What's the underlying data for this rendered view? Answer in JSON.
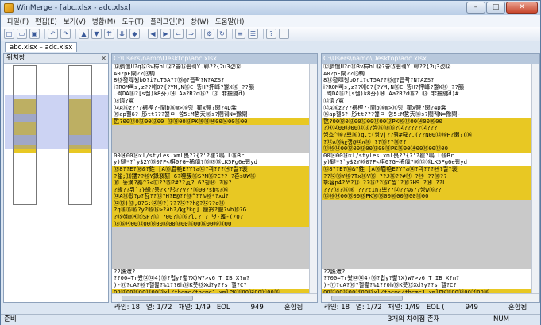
{
  "window": {
    "title": "WinMerge - [abc.xlsx - adc.xlsx]",
    "minimize": "–",
    "maximize": "□",
    "close": "✕"
  },
  "menu": [
    "파일(F)",
    "편집(E)",
    "보기(V)",
    "병합(M)",
    "도구(T)",
    "플러그인(P)",
    "창(W)",
    "도움말(H)"
  ],
  "toolbar_icons": [
    "new-icon",
    "open-icon",
    "save-icon",
    "sep",
    "undo-icon",
    "redo-icon",
    "sep",
    "prev-diff-icon",
    "next-diff-icon",
    "first-diff-icon",
    "last-diff-icon",
    "current-diff-icon",
    "sep",
    "copy-left-icon",
    "copy-right-icon",
    "copy-all-left-icon",
    "copy-all-right-icon",
    "sep",
    "options-icon",
    "refresh-icon",
    "sep",
    "compare-icon",
    "settings-icon",
    "sep",
    "help-icon",
    "about-icon"
  ],
  "tab": {
    "label": "abc.xlsx – adc.xlsx"
  },
  "location_pane": {
    "title": "위치창",
    "close": "✕"
  },
  "left": {
    "path": "C:\\Users\\namo\\Desktop\\abc.xlsx",
    "status": {
      "line": "라인: 18",
      "col": "열: 1/72",
      "char": "채널: 1/49",
      "eol": "EOL",
      "count": "949",
      "encoding": "혼합됨"
    },
    "lines": [
      {
        "t": "⑫臍慍U?q⑫3v椧hL⑫?쓩⑮휩퀘Y.鄲??{2ц3갮⑫",
        "k": ""
      },
      {
        "t": "A0?pF閘??⒀騊",
        "k": ""
      },
      {
        "t": "8⑮發噑뉭bD?i?cT5A??⑮@?흡좍?N?AZS?",
        "k": ""
      },
      {
        "t": "ⅰ?ROM삐s,z??얘0?{?YM,N⑯C 똥H?押峰?쐟X⑯_??韻",
        "k": ""
      },
      {
        "t": ".쩍DA⑯?[s쏄)k8芬)⑭ Aa?R?d⑯?  ⑬ 罪擔纏d)",
        "k": ""
      },
      {
        "t": "⑬遺?寬",
        "k": ""
      },
      {
        "t": "⑫A⑯z???襛樫?-閘b⑯W>⑯링  瞿x鹽?閑?4D喬",
        "k": ""
      },
      {
        "t": "⑯ap펠6?~肜tt???쐝ㅁ 쓩5:M乴天⑱s?閤퀘N=豫閘-",
        "k": ""
      },
      {
        "t": "乴?00⑬0⑬00⑬00  ⑬⑬00⑬PK⑯⑬⑭00⑭00⑯00",
        "k": "diff"
      },
      {
        "t": "",
        "k": "gap"
      },
      {
        "t": "",
        "k": "gap"
      },
      {
        "t": "",
        "k": "gap"
      },
      {
        "t": "",
        "k": "gap"
      },
      {
        "t": "00⑭00⑭xl/styles.xml畏??{?'?瞿?鳴 L⑯Br",
        "k": ""
      },
      {
        "t": "y)鐽*?`y$2Y⑯0?F<棋0?G~稀偉?⑯⑬⑯LK5Fg6e휩yd",
        "k": ""
      },
      {
        "t": "⑬8??E?⑱&?鉎 [A⑯眉艳E?Y?a⑫?긔???⑭?릴?裵",
        "k": "diff"
      },
      {
        "t": "?쑕;⒀鏤??⑯Y錄裵豣 6?噬簇⑯S?M⑯?C?? ?혼sUW⑯",
        "k": "diff"
      },
      {
        "t": "⑯ 똥溝?蓁^?<⑰??⑮?#??瓦? 6?뉭⑭ ?⑯?",
        "k": "diff"
      },
      {
        "t": "?緣??뤼`?}緣?뚱?k?肜??v??⑯00?sb%?⑯",
        "k": "diff"
      },
      {
        "t": "⑫A⑯탔?p?瓦??⑬?H?E@??⑬^??%⑯*?xd?",
        "k": "diff"
      },
      {
        "t": "⑫⑬)⑬,0?S:⑫⑫?)???⑫??h@?⑫??o⑬ ",
        "k": "diff"
      },
      {
        "t": "?q⑯⑯⑯?y?⑯⑯>?∂h?/㎏?kg] 瘦鈴?鹽?vb⑯?G",
        "k": "diff"
      },
      {
        "t": "?⑮혀@⑭⑮SP?⑬ ?00?⑬⑯?l.?  ?  볏-䩁-(/0?",
        "k": "diff"
      },
      {
        "t": "⑬⑯⑭00⑬00⑬00⑬00⑬00⑯00⑯00⑯⑬00",
        "k": "diff"
      },
      {
        "t": "",
        "k": "gap"
      },
      {
        "t": "",
        "k": "gap"
      },
      {
        "t": "",
        "k": "gap"
      },
      {
        "t": "",
        "k": "gap"
      },
      {
        "t": "",
        "k": "gap"
      },
      {
        "t": "",
        "k": "gap"
      },
      {
        "t": "?2讗遭?",
        "k": ""
      },
      {
        "t": "??00=Tr쐈⑫⑫4)⑯?렵y?쐝?X)W?>v6 T IB   X?m?",
        "k": ""
      },
      {
        "t": ")-⑪?cA?⑯?헬쬝?%1??0h⑮K쯧⑮Xd?y??s 헬?C?",
        "k": ""
      },
      {
        "t": "00⑬00⑯00⑭00⑬xl/theme/theme1.xmlPK⑪00⑫00⑭00⑯",
        "k": "diff"
      },
      {
        "t": "⑬00 ⑬00⑭00⑬ ⑯00 ⑬00⑯00⑯00⑬ ⑭00 ⑬00",
        "k": "diff"
      }
    ]
  },
  "right": {
    "path": "C:\\Users\\namo\\Desktop\\adc.xlsx",
    "status": {
      "line": "라인: 18",
      "col": "열: 1/72",
      "char": "채널: 1/49",
      "eol": "EOL (",
      "count": "949",
      "encoding": "혼합됨"
    },
    "lines": [
      {
        "t": "⑫臍慍U?q⑫3v椧hL⑫?쓩⑮휩퀘Y.鄲??{2ц3갮⑫",
        "k": ""
      },
      {
        "t": "A0?pF閘??⒀騊",
        "k": ""
      },
      {
        "t": "8⑮發噑뉭bD?i?cT5A??⑮@?흡좍?N?AZS?",
        "k": ""
      },
      {
        "t": "ⅰ?ROM삐s,z??얘0?{?YM,N⑯C 똥H?押峰?쐟X⑯_??韻",
        "k": ""
      },
      {
        "t": ".쩍DA⑯?[s쏄)k8芬)⑭ Aa?R?d⑯?  ⑬ 罪擔纏d)#",
        "k": ""
      },
      {
        "t": "⑬遺?寬",
        "k": ""
      },
      {
        "t": "⑫A⑯z???襛樫?-閘b⑯W>⑯링  瞿x鹽?閑?4D喬",
        "k": ""
      },
      {
        "t": "⑯ap펠6?~肜tt???쐝ㅁ 쓩5:M乴天⑱s?閤퀘N=豫閘-",
        "k": ""
      },
      {
        "t": "乴?00⑬0⑬00⑬00⑬00⑬PK⑯⑬00⑭00⑯00",
        "k": "diff"
      },
      {
        "t": "?⑭⑫00⑬00⑬⑬?쌍⑯⑬⑯?⑫?????⑫???",
        "k": "diff"
      },
      {
        "t": "쌍쇼^⑯?쁘⑯)q.t(쌍v|??쬠#舜?.(??N00⑬⑯F?懶?(⑯",
        "k": "diff"
      },
      {
        "t": "?⑫ʌ⑯㎏쟁@⑫ʌ⑯ ??⑯??⑯??",
        "k": "diff"
      },
      {
        "t": "⑬⑯⑭00⑬00⑬00⑬00⑬PK⑯00⑭00⑯00⑬00",
        "k": "diff"
      },
      {
        "t": "00⑭00⑭xl/styles.xml畏??{?'?瞿?鳴 L⑯Br",
        "k": ""
      },
      {
        "t": "y)鐽*?`y$2Y⑯0?F<棋0?G~稀偉?⑯⑬⑯LK5Fg6e휩yd",
        "k": ""
      },
      {
        "t": "⑬8??E?⑱&?鉎 [A⑯眉艳E?Y?a⑫?긔???⑭?릴?裵",
        "k": "diff"
      },
      {
        "t": "??⑫⑱Y⑯?Tx⑯V⑮ ??J⑯??#⑭ ?⑭ ??⑯??",
        "k": "diff"
      },
      {
        "t": "彰容p4?쏘?⑬ ??⑮??⑯C쌍`?⑯?H9 ?⑭ ??L",
        "k": "diff"
      },
      {
        "t": "???⑬?⑯⑱ ???t1n?쁘??⑫??%6??쌍w⑯??",
        "k": "diff"
      },
      {
        "t": "⑬⑯⑭00⑬00⑬PK⑯⑬00⑯00⑬00⑯00",
        "k": "diff"
      },
      {
        "t": "",
        "k": "gap"
      },
      {
        "t": "",
        "k": "gap"
      },
      {
        "t": "",
        "k": "gap"
      },
      {
        "t": "",
        "k": "gap"
      },
      {
        "t": "",
        "k": "gap"
      },
      {
        "t": "",
        "k": "gap"
      },
      {
        "t": "",
        "k": "gap"
      },
      {
        "t": "",
        "k": "gap"
      },
      {
        "t": "",
        "k": "gap"
      },
      {
        "t": "",
        "k": "gap"
      },
      {
        "t": "?2讗遭?",
        "k": ""
      },
      {
        "t": "??00=Tr쐈⑫⑫4)⑯?렵y?쐝?X)W?>v6 T IB   X?m?",
        "k": ""
      },
      {
        "t": ")-⑪?cA?⑯?헬쬝?%1??0h⑮K쯧⑮Xd?y??s 헬?C?",
        "k": ""
      },
      {
        "t": "00⑬00⑯00⑭00⑬xl/theme/theme1.xmlPK⑪00⑫00⑭00⑯",
        "k": "diff"
      },
      {
        "t": "⑬00 ⑬00⑭00⑬ ⑯00 ⑬00⑯00⑯00⑬ ⑭00 ⑬00",
        "k": "diff"
      }
    ]
  },
  "statusbar": {
    "left": "준비",
    "diffs": "3개의 차이점 존재",
    "num": "NUM"
  },
  "colors": {
    "diff": "#e8c823",
    "gap": "#c9c9c9",
    "view": "#6e82dc"
  }
}
